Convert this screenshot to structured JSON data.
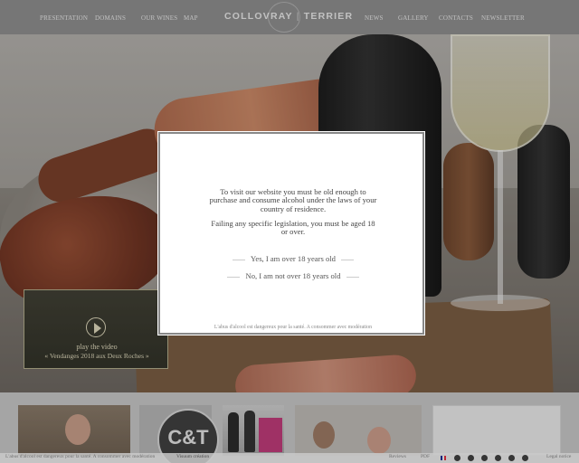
{
  "header": {
    "nav_left": [
      "PRESENTATION",
      "DOMAINS",
      "OUR WINES",
      "MAP"
    ],
    "logo_left": "COLLOVRAY",
    "logo_sep": "|",
    "logo_right": "TERRIER",
    "nav_right": [
      "NEWS",
      "GALLERY",
      "CONTACTS",
      "NEWSLETTER"
    ]
  },
  "video": {
    "label": "play the video",
    "title": "« Vendanges 2018 aux Deux Roches »"
  },
  "modal": {
    "message": "To visit our website you must be old enough to purchase and consume alcohol under the laws of your country of residence.",
    "message2": "Failing any specific legislation, you must be aged 18 or over.",
    "yes_label": "Yes, I am over 18 years old",
    "no_label": "No, I am not over 18 years old",
    "warning": "L'abus d'alcool est dangereux pour la santé. A consommer avec modération"
  },
  "thumbs": {
    "seal_text": "C&T"
  },
  "footer": {
    "disclaimer": "L'abus d'alcool est dangereux pour la santé. A consommer avec modération",
    "credit": "Visuum création",
    "reviews": "Reviews",
    "pdf": "PDF",
    "legal": "Legal notice"
  },
  "colors": {
    "header_bg": "#787878",
    "modal_border": "#888888",
    "footer_bg": "#ffffff"
  }
}
